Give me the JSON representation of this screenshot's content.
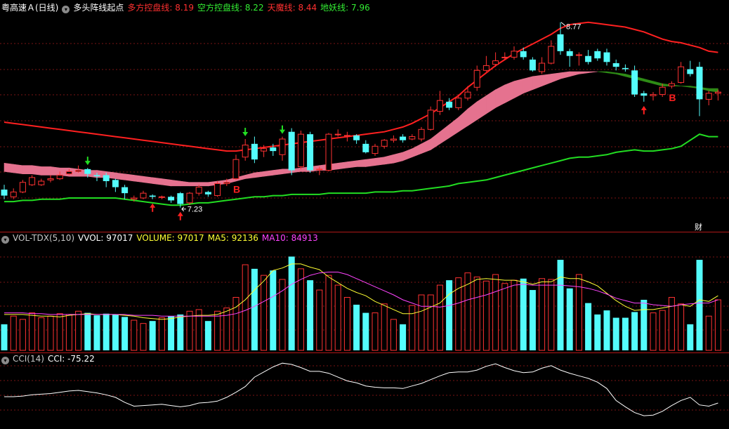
{
  "header_main": {
    "stock": "粤高速Ａ(日线)",
    "indicator": "多头阵线起点",
    "duo_label": "多方控盘线:",
    "duo_value": "8.19",
    "kong_label": "空方控盘线:",
    "kong_value": "8.22",
    "tian_label": "天魔线:",
    "tian_value": "8.44",
    "di_label": "地妖线:",
    "di_value": "7.96"
  },
  "header_vol": {
    "name": "VOL-TDX(5,10)",
    "vvol": "VVOL: 97017",
    "volume": "VOLUME: 97017",
    "ma5": "MA5: 92136",
    "ma10": "MA10: 84913"
  },
  "header_cci": {
    "name": "CCI(14)",
    "cci": "CCI: -75.22"
  },
  "annotations": {
    "high": "8.77",
    "low": "7.23",
    "buy1": "B",
    "buy2": "B",
    "cai": "财"
  },
  "colors": {
    "up": "#ff3232",
    "down": "#54fcfc",
    "tian": "#ff2020",
    "di": "#22dd22",
    "band_bull": "#e5728f",
    "band_bear": "#2e8b16",
    "ma5": "#ffff33",
    "ma10": "#ff44ff",
    "cci": "#ffffff",
    "grid": "#7a1515"
  },
  "chart_data": [
    {
      "type": "candlestick",
      "title": "粤高速Ａ(日线)",
      "ylim": [
        7.1,
        8.85
      ],
      "high_mark": 8.77,
      "low_mark": 7.23,
      "candles": [
        [
          7.38,
          7.33,
          7.42,
          7.3
        ],
        [
          7.32,
          7.36,
          7.39,
          7.3
        ],
        [
          7.36,
          7.44,
          7.46,
          7.35
        ],
        [
          7.42,
          7.48,
          7.5,
          7.41
        ],
        [
          7.42,
          7.45,
          7.47,
          7.41
        ],
        [
          7.46,
          7.47,
          7.5,
          7.44
        ],
        [
          7.47,
          7.5,
          7.53,
          7.46
        ],
        [
          7.51,
          7.53,
          7.55,
          7.5
        ],
        [
          7.53,
          7.54,
          7.58,
          7.52
        ],
        [
          7.55,
          7.51,
          7.56,
          7.48
        ],
        [
          7.5,
          7.49,
          7.52,
          7.45
        ],
        [
          7.5,
          7.45,
          7.52,
          7.4
        ],
        [
          7.46,
          7.4,
          7.47,
          7.36
        ],
        [
          7.4,
          7.35,
          7.42,
          7.3
        ],
        [
          7.3,
          7.31,
          7.33,
          7.28
        ],
        [
          7.31,
          7.35,
          7.37,
          7.3
        ],
        [
          7.33,
          7.32,
          7.34,
          7.3
        ],
        [
          7.32,
          7.32,
          7.33,
          7.3
        ],
        [
          7.32,
          7.29,
          7.33,
          7.27
        ],
        [
          7.35,
          7.26,
          7.36,
          7.23
        ],
        [
          7.27,
          7.35,
          7.36,
          7.25
        ],
        [
          7.35,
          7.4,
          7.42,
          7.33
        ],
        [
          7.36,
          7.34,
          7.37,
          7.32
        ],
        [
          7.33,
          7.43,
          7.45,
          7.32
        ],
        [
          7.43,
          7.44,
          7.47,
          7.41
        ],
        [
          7.47,
          7.63,
          7.67,
          7.46
        ],
        [
          7.65,
          7.75,
          7.8,
          7.62
        ],
        [
          7.76,
          7.63,
          7.82,
          7.6
        ],
        [
          7.7,
          7.72,
          7.75,
          7.65
        ],
        [
          7.73,
          7.7,
          7.76,
          7.66
        ],
        [
          7.67,
          7.8,
          7.82,
          7.62
        ],
        [
          7.86,
          7.54,
          7.89,
          7.5
        ],
        [
          7.57,
          7.84,
          7.87,
          7.55
        ],
        [
          7.84,
          7.54,
          7.86,
          7.52
        ],
        [
          7.55,
          7.55,
          7.57,
          7.5
        ],
        [
          7.54,
          7.84,
          7.85,
          7.53
        ],
        [
          7.84,
          7.84,
          7.88,
          7.82
        ],
        [
          7.83,
          7.83,
          7.86,
          7.78
        ],
        [
          7.83,
          7.79,
          7.84,
          7.76
        ],
        [
          7.76,
          7.69,
          7.79,
          7.68
        ],
        [
          7.68,
          7.74,
          7.76,
          7.66
        ],
        [
          7.74,
          7.79,
          7.8,
          7.72
        ],
        [
          7.79,
          7.8,
          7.83,
          7.77
        ],
        [
          7.82,
          7.79,
          7.84,
          7.77
        ],
        [
          7.8,
          7.82,
          7.84,
          7.79
        ],
        [
          7.8,
          7.88,
          7.9,
          7.78
        ],
        [
          7.88,
          8.04,
          8.07,
          7.87
        ],
        [
          8.03,
          8.12,
          8.2,
          8.0
        ],
        [
          8.11,
          8.06,
          8.14,
          8.04
        ],
        [
          8.06,
          8.14,
          8.17,
          8.04
        ],
        [
          8.14,
          8.19,
          8.24,
          8.12
        ],
        [
          8.23,
          8.37,
          8.41,
          8.2
        ],
        [
          8.37,
          8.41,
          8.49,
          8.36
        ],
        [
          8.42,
          8.45,
          8.52,
          8.4
        ],
        [
          8.48,
          8.48,
          8.52,
          8.46
        ],
        [
          8.48,
          8.53,
          8.57,
          8.46
        ],
        [
          8.53,
          8.48,
          8.56,
          8.46
        ],
        [
          8.46,
          8.37,
          8.48,
          8.36
        ],
        [
          8.36,
          8.43,
          8.48,
          8.34
        ],
        [
          8.43,
          8.57,
          8.62,
          8.42
        ],
        [
          8.67,
          8.53,
          8.77,
          8.5
        ],
        [
          8.53,
          8.49,
          8.55,
          8.4
        ],
        [
          8.5,
          8.5,
          8.52,
          8.41
        ],
        [
          8.49,
          8.44,
          8.54,
          8.42
        ],
        [
          8.53,
          8.47,
          8.55,
          8.45
        ],
        [
          8.52,
          8.44,
          8.55,
          8.41
        ],
        [
          8.43,
          8.4,
          8.46,
          8.37
        ],
        [
          8.39,
          8.38,
          8.42,
          8.36
        ],
        [
          8.37,
          8.17,
          8.41,
          8.15
        ],
        [
          8.18,
          8.16,
          8.2,
          8.11
        ],
        [
          8.16,
          8.17,
          8.19,
          8.12
        ],
        [
          8.17,
          8.23,
          8.26,
          8.15
        ],
        [
          8.24,
          8.26,
          8.28,
          8.22
        ],
        [
          8.27,
          8.4,
          8.44,
          8.26
        ],
        [
          8.38,
          8.34,
          8.45,
          8.32
        ],
        [
          8.4,
          8.13,
          8.44,
          7.99
        ],
        [
          8.13,
          8.18,
          8.2,
          8.08
        ],
        [
          8.18,
          8.19,
          8.21,
          8.12
        ]
      ],
      "tian_line": [
        7.94,
        7.93,
        7.92,
        7.91,
        7.9,
        7.89,
        7.88,
        7.87,
        7.86,
        7.85,
        7.84,
        7.83,
        7.82,
        7.81,
        7.8,
        7.79,
        7.78,
        7.77,
        7.76,
        7.75,
        7.74,
        7.73,
        7.72,
        7.71,
        7.7,
        7.7,
        7.71,
        7.72,
        7.73,
        7.74,
        7.75,
        7.76,
        7.77,
        7.78,
        7.79,
        7.8,
        7.81,
        7.82,
        7.83,
        7.84,
        7.85,
        7.86,
        7.88,
        7.9,
        7.93,
        7.97,
        8.01,
        8.06,
        8.11,
        8.16,
        8.23,
        8.29,
        8.35,
        8.41,
        8.46,
        8.51,
        8.55,
        8.59,
        8.63,
        8.67,
        8.72,
        8.75,
        8.76,
        8.77,
        8.76,
        8.75,
        8.74,
        8.73,
        8.71,
        8.69,
        8.66,
        8.63,
        8.61,
        8.6,
        8.58,
        8.56,
        8.53,
        8.52
      ],
      "di_line": [
        7.28,
        7.28,
        7.29,
        7.29,
        7.3,
        7.3,
        7.3,
        7.31,
        7.31,
        7.31,
        7.31,
        7.31,
        7.31,
        7.3,
        7.29,
        7.28,
        7.27,
        7.26,
        7.25,
        7.25,
        7.26,
        7.27,
        7.27,
        7.28,
        7.29,
        7.3,
        7.31,
        7.32,
        7.32,
        7.33,
        7.33,
        7.34,
        7.34,
        7.34,
        7.34,
        7.35,
        7.35,
        7.35,
        7.35,
        7.35,
        7.36,
        7.36,
        7.36,
        7.37,
        7.37,
        7.38,
        7.39,
        7.4,
        7.41,
        7.43,
        7.44,
        7.45,
        7.46,
        7.48,
        7.5,
        7.52,
        7.54,
        7.56,
        7.58,
        7.6,
        7.62,
        7.64,
        7.65,
        7.65,
        7.66,
        7.67,
        7.69,
        7.7,
        7.71,
        7.7,
        7.7,
        7.71,
        7.72,
        7.74,
        7.79,
        7.84,
        7.82,
        7.82
      ],
      "duo_line": [
        7.6,
        7.59,
        7.58,
        7.58,
        7.57,
        7.57,
        7.56,
        7.56,
        7.55,
        7.54,
        7.54,
        7.53,
        7.52,
        7.51,
        7.5,
        7.49,
        7.48,
        7.47,
        7.46,
        7.45,
        7.44,
        7.44,
        7.44,
        7.45,
        7.46,
        7.48,
        7.5,
        7.52,
        7.53,
        7.54,
        7.55,
        7.55,
        7.56,
        7.57,
        7.58,
        7.59,
        7.6,
        7.61,
        7.62,
        7.63,
        7.64,
        7.65,
        7.67,
        7.69,
        7.72,
        7.76,
        7.8,
        7.86,
        7.92,
        7.98,
        8.05,
        8.11,
        8.16,
        8.21,
        8.25,
        8.28,
        8.3,
        8.32,
        8.33,
        8.34,
        8.35,
        8.36,
        8.36,
        8.36,
        8.36,
        8.35,
        8.34,
        8.32,
        8.3,
        8.28,
        8.26,
        8.24,
        8.24,
        8.24,
        8.23,
        8.22,
        8.2,
        8.19
      ],
      "kong_line": [
        7.53,
        7.52,
        7.51,
        7.51,
        7.5,
        7.5,
        7.5,
        7.49,
        7.49,
        7.49,
        7.48,
        7.48,
        7.47,
        7.46,
        7.45,
        7.44,
        7.43,
        7.42,
        7.41,
        7.41,
        7.41,
        7.41,
        7.41,
        7.42,
        7.43,
        7.45,
        7.47,
        7.48,
        7.49,
        7.5,
        7.51,
        7.52,
        7.53,
        7.53,
        7.54,
        7.54,
        7.55,
        7.56,
        7.57,
        7.57,
        7.58,
        7.59,
        7.6,
        7.62,
        7.65,
        7.68,
        7.71,
        7.76,
        7.81,
        7.86,
        7.91,
        7.96,
        8.01,
        8.06,
        8.1,
        8.14,
        8.18,
        8.21,
        8.24,
        8.27,
        8.3,
        8.32,
        8.34,
        8.35,
        8.36,
        8.36,
        8.35,
        8.34,
        8.32,
        8.3,
        8.28,
        8.26,
        8.25,
        8.24,
        8.24,
        8.23,
        8.22,
        8.22
      ],
      "up_arrows": [
        16,
        19,
        69
      ],
      "down_arrows": [
        9,
        26,
        30
      ],
      "buy_marks": [
        [
          25,
          "buy1"
        ],
        [
          72,
          "buy2"
        ]
      ]
    },
    {
      "type": "bar",
      "title": "VOL-TDX(5,10)",
      "ylim": [
        0,
        130000
      ],
      "volumes": [
        32000,
        42000,
        38000,
        46000,
        40000,
        42000,
        45000,
        44000,
        48000,
        46000,
        43000,
        45000,
        44000,
        41000,
        37000,
        33000,
        36000,
        40000,
        42000,
        44000,
        48000,
        50000,
        36000,
        48000,
        52000,
        65000,
        105000,
        100000,
        92000,
        98000,
        87000,
        115000,
        100000,
        86000,
        74000,
        92000,
        80000,
        65000,
        56000,
        46000,
        46000,
        57000,
        38000,
        32000,
        55000,
        68000,
        68000,
        80000,
        86000,
        89000,
        95000,
        90000,
        85000,
        93000,
        82000,
        86000,
        88000,
        74000,
        88000,
        87000,
        111000,
        76000,
        93000,
        58000,
        44000,
        49000,
        40000,
        40000,
        47000,
        62000,
        46000,
        49000,
        65000,
        57000,
        32000,
        111000,
        42000,
        62000
      ],
      "ma5": [
        44000,
        44000,
        44000,
        43000,
        42000,
        42000,
        41000,
        43000,
        44000,
        45000,
        44000,
        44000,
        44000,
        43000,
        42000,
        40000,
        39000,
        38000,
        39000,
        41000,
        42000,
        43000,
        43000,
        44000,
        48000,
        53000,
        62000,
        74000,
        85000,
        98000,
        101000,
        106000,
        106000,
        102000,
        99000,
        90000,
        83000,
        76000,
        71000,
        67000,
        60000,
        55000,
        50000,
        45000,
        45000,
        48000,
        53000,
        58000,
        69000,
        76000,
        81000,
        87000,
        88000,
        87000,
        86000,
        86000,
        84000,
        81000,
        84000,
        84000,
        90000,
        88000,
        88000,
        84000,
        79000,
        70000,
        61000,
        54000,
        49000,
        50000,
        50000,
        52000,
        54000,
        56000,
        54000,
        62000,
        60000,
        67000
      ],
      "ma10": [
        46000,
        46000,
        46000,
        45000,
        45000,
        44000,
        44000,
        44000,
        44000,
        44000,
        44000,
        44000,
        44000,
        44000,
        43000,
        43000,
        43000,
        42000,
        42000,
        42000,
        42000,
        42000,
        42000,
        42000,
        43000,
        45000,
        49000,
        54000,
        60000,
        66000,
        73000,
        81000,
        87000,
        92000,
        95000,
        96000,
        96000,
        93000,
        88000,
        83000,
        78000,
        73000,
        68000,
        62000,
        58000,
        54000,
        54000,
        53000,
        55000,
        58000,
        62000,
        65000,
        68000,
        72000,
        76000,
        80000,
        81000,
        80000,
        80000,
        80000,
        80000,
        79000,
        78000,
        76000,
        73000,
        69000,
        64000,
        61000,
        58000,
        58000,
        56000,
        55000,
        54000,
        56000,
        57000,
        58000,
        58000,
        62000
      ]
    },
    {
      "type": "line",
      "title": "CCI(14)",
      "ylim": [
        -280,
        280
      ],
      "cci": [
        -25,
        -25,
        -20,
        -10,
        -5,
        0,
        10,
        20,
        25,
        15,
        5,
        -10,
        -30,
        -70,
        -100,
        -95,
        -90,
        -85,
        -95,
        -105,
        -95,
        -75,
        -70,
        -60,
        -30,
        10,
        55,
        130,
        170,
        210,
        240,
        230,
        205,
        175,
        175,
        160,
        130,
        100,
        85,
        60,
        50,
        45,
        45,
        40,
        60,
        80,
        110,
        140,
        165,
        170,
        170,
        185,
        215,
        235,
        205,
        180,
        165,
        170,
        200,
        220,
        185,
        160,
        140,
        120,
        90,
        40,
        -55,
        -105,
        -150,
        -175,
        -170,
        -140,
        -95,
        -55,
        -30,
        -90,
        -100,
        -75
      ]
    }
  ]
}
